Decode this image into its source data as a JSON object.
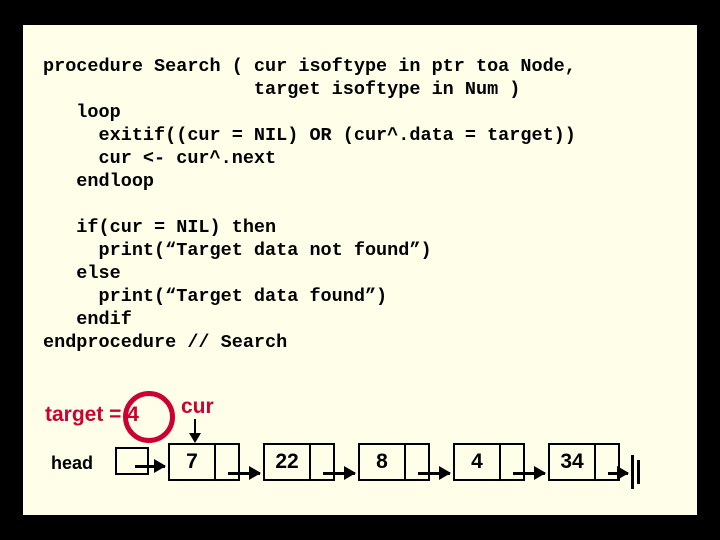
{
  "code": {
    "l1": "procedure Search ( cur isoftype in ptr toa Node,",
    "l2": "                   target isoftype in Num )",
    "l3": "   loop",
    "l4": "     exitif((cur = NIL) OR (cur^.data = target))",
    "l5": "     cur <- cur^.next",
    "l6": "   endloop",
    "l7": "",
    "l8": "   if(cur = NIL) then",
    "l9": "     print(“Target data not found”)",
    "l10": "   else",
    "l11": "     print(“Target data found”)",
    "l12": "   endif",
    "l13": "endprocedure // Search"
  },
  "labels": {
    "target": "target = 4",
    "head": "head",
    "cur": "cur"
  },
  "nodes": {
    "n1": "7",
    "n2": "22",
    "n3": "8",
    "n4": "4",
    "n5": "34"
  },
  "chart_data": {
    "type": "table",
    "title": "Linked list search trace",
    "target_value": 4,
    "cur_points_to_index": 0,
    "list": [
      7,
      22,
      8,
      4,
      34
    ]
  }
}
